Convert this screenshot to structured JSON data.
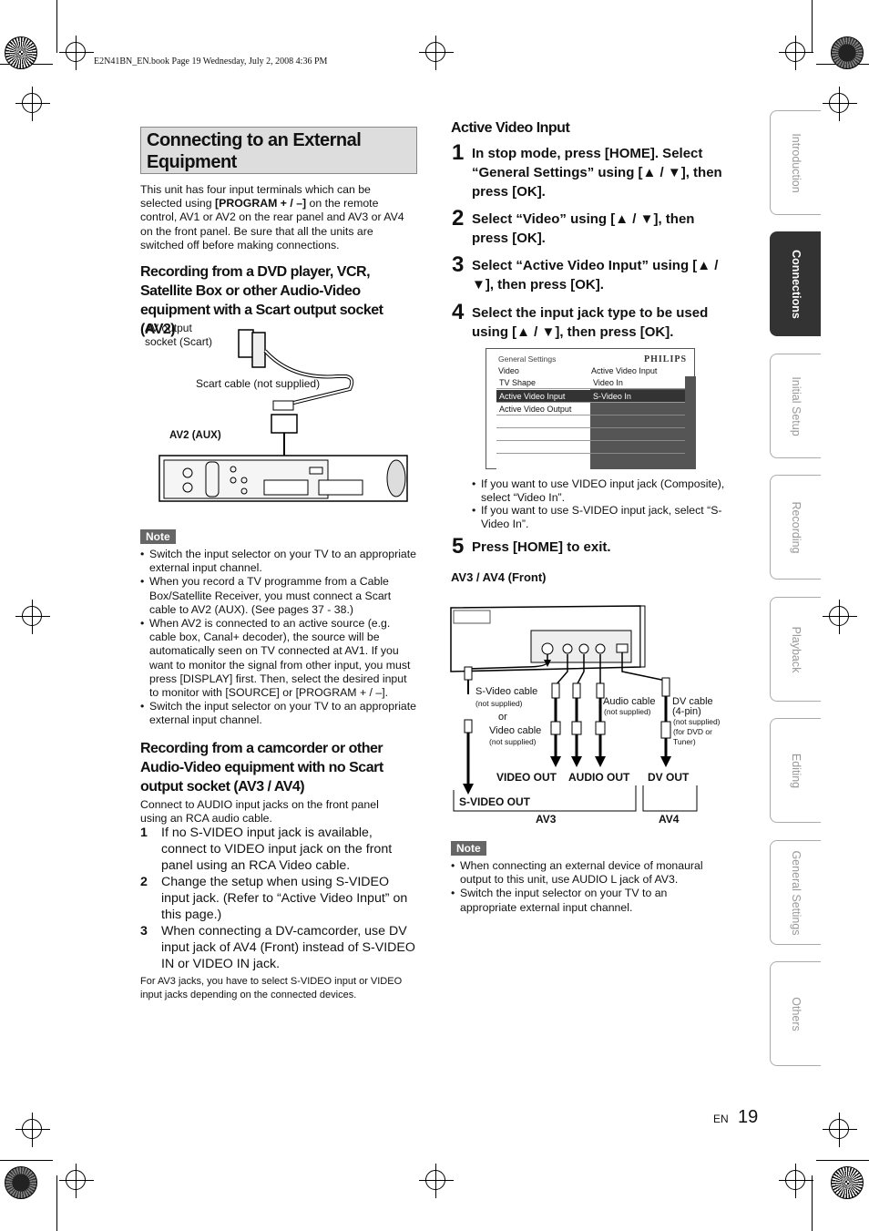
{
  "header": "E2N41BN_EN.book  Page 19  Wednesday, July 2, 2008  4:36 PM",
  "section_title": "Connecting to an External Equipment",
  "intro": [
    {
      "t": "This unit has four input terminals which can be selected using "
    },
    {
      "b": "[PROGRAM + / –]"
    },
    {
      "t": " on the remote control, AV1 or AV2 on the rear panel and AV3 or AV4 on the front panel. Be sure that all the units are switched off before making connections."
    }
  ],
  "heading_av2": "Recording from a DVD player, VCR, Satellite Box or other Audio-Video equipment with a Scart output socket (AV2)",
  "diagram_av2": {
    "av_output": "AV output socket (Scart)",
    "scart_cable": "Scart cable (not supplied)",
    "av2_aux": "AV2 (AUX)"
  },
  "note_label": "Note",
  "note1": [
    "Switch the input selector on your TV to an appropriate external input channel.",
    "When you record a TV programme from a Cable Box/Satellite Receiver, you must connect a Scart cable to AV2 (AUX). (See pages 37 - 38.)",
    "When AV2 is connected to an active source (e.g. cable box, Canal+ decoder), the source will be automatically seen on TV connected at AV1. If you want to monitor the signal from other input, you must press [DISPLAY] first. Then, select the desired input to monitor with [SOURCE] or [PROGRAM + / –].",
    "Switch the input selector on your TV to an appropriate external input channel."
  ],
  "heading_av34": "Recording from a camcorder or other Audio-Video equipment with no Scart output socket (AV3 / AV4)",
  "av34_intro": "Connect to AUDIO input jacks on the front panel using an RCA audio cable.",
  "av34_list": [
    {
      "n": "1",
      "t": "If no S-VIDEO input jack is available, connect to VIDEO input jack on the front panel using an RCA Video cable."
    },
    {
      "n": "2",
      "t": "Change the setup when using S-VIDEO input jack. (Refer to “Active Video Input” on this page.)"
    },
    {
      "n": "3",
      "t": "When connecting a DV-camcorder, use DV input jack of AV4 (Front) instead of S-VIDEO IN or VIDEO IN jack."
    }
  ],
  "av34_footnote": "For AV3 jacks, you have to select S-VIDEO input or VIDEO input jacks depending on the connected devices.",
  "avi_heading": "Active Video Input",
  "steps": [
    {
      "n": "1",
      "t": "In stop mode, press [HOME]. Select “General Settings” using [▲ / ▼], then press [OK]."
    },
    {
      "n": "2",
      "t": "Select “Video” using [▲ / ▼], then press [OK]."
    },
    {
      "n": "3",
      "t": "Select “Active Video Input” using [▲ / ▼], then press [OK]."
    },
    {
      "n": "4",
      "t": "Select the input jack type to be used using [▲ / ▼], then press [OK]."
    },
    {
      "n": "5",
      "t": "Press [HOME] to exit."
    }
  ],
  "menu": {
    "title": "General Settings",
    "brand": "PHILIPS",
    "left_header": "Video",
    "right_header": "Active Video Input",
    "left_items": [
      "TV Shape",
      "Active Video Input",
      "Active Video Output"
    ],
    "right_items": [
      "Video In",
      "S-Video In"
    ]
  },
  "step4_bullets": [
    "If you want to use VIDEO input jack (Composite), select “Video In”.",
    "If you want to use S-VIDEO input jack, select “S-Video In”."
  ],
  "av34_front_label": "AV3 / AV4 (Front)",
  "diagram_front": {
    "svideo_cable": "S-Video cable",
    "not_supplied": "(not supplied)",
    "or": "or",
    "video_cable": "Video cable",
    "audio_cable": "Audio cable",
    "dv_cable": "DV cable",
    "dv_pin": "(4-pin)",
    "dv_note1": "(not supplied)",
    "dv_note2": "(for DVD or",
    "dv_note3": "Tuner)",
    "video_out": "VIDEO OUT",
    "audio_out": "AUDIO OUT",
    "dv_out": "DV OUT",
    "svideo_out": "S-VIDEO OUT",
    "av3": "AV3",
    "av4": "AV4"
  },
  "note2": [
    "When connecting an external device of monaural output to this unit, use AUDIO L jack of AV3.",
    "Switch the input selector on your TV to an appropriate external input channel."
  ],
  "tabs": [
    "Introduction",
    "Connections",
    "Initial Setup",
    "Recording",
    "Playback",
    "Editing",
    "General Settings",
    "Others"
  ],
  "active_tab": "Connections",
  "footer": {
    "lang": "EN",
    "page": "19"
  }
}
